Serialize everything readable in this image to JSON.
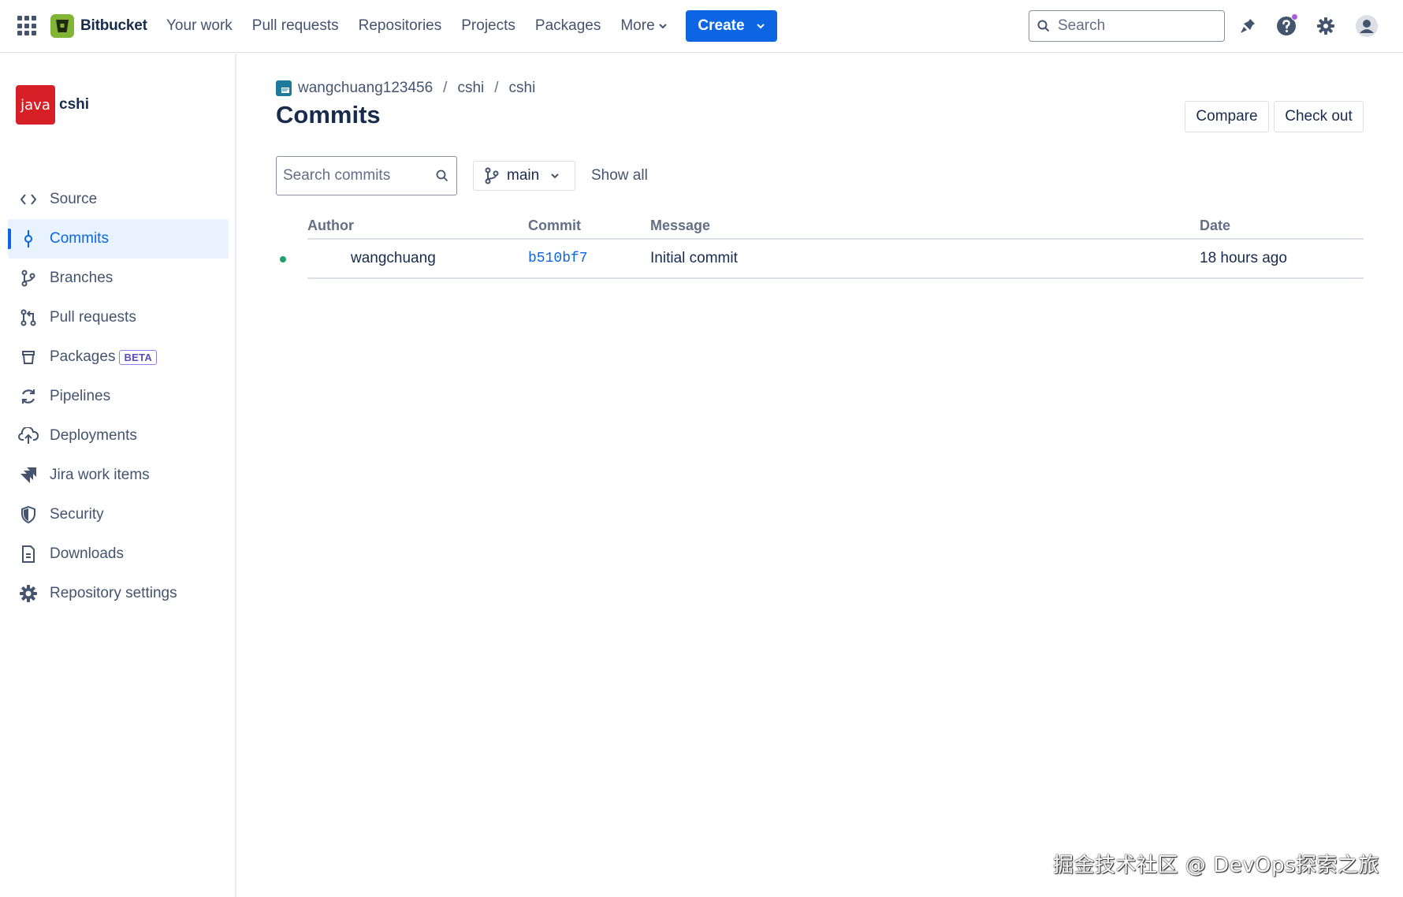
{
  "topnav": {
    "logo_text": "Bitbucket",
    "links": [
      "Your work",
      "Pull requests",
      "Repositories",
      "Projects",
      "Packages"
    ],
    "more_label": "More",
    "create_label": "Create",
    "search_placeholder": "Search",
    "accent": "#0c66e4"
  },
  "sidebar": {
    "repo_avatar_text": "java",
    "repo_name": "cshi",
    "items": [
      {
        "label": "Source",
        "icon": "code-icon"
      },
      {
        "label": "Commits",
        "icon": "commit-icon",
        "active": true
      },
      {
        "label": "Branches",
        "icon": "branch-icon"
      },
      {
        "label": "Pull requests",
        "icon": "pull-request-icon"
      },
      {
        "label": "Packages",
        "icon": "package-icon",
        "badge": "BETA"
      },
      {
        "label": "Pipelines",
        "icon": "pipelines-icon"
      },
      {
        "label": "Deployments",
        "icon": "cloud-upload-icon"
      },
      {
        "label": "Jira work items",
        "icon": "jira-icon"
      },
      {
        "label": "Security",
        "icon": "shield-icon"
      },
      {
        "label": "Downloads",
        "icon": "file-icon"
      },
      {
        "label": "Repository settings",
        "icon": "gear-icon"
      }
    ]
  },
  "main": {
    "breadcrumb": [
      "wangchuang123456",
      "cshi",
      "cshi"
    ],
    "title": "Commits",
    "compare_label": "Compare",
    "checkout_label": "Check out",
    "search_placeholder": "Search commits",
    "branch": "main",
    "show_all_label": "Show all",
    "table": {
      "headers": [
        "Author",
        "Commit",
        "Message",
        "Date"
      ],
      "rows": [
        {
          "author": "wangchuang",
          "commit": "b510bf7",
          "message": "Initial commit",
          "date": "18 hours ago"
        }
      ]
    }
  },
  "watermark": "掘金技术社区 @ DevOps探索之旅"
}
